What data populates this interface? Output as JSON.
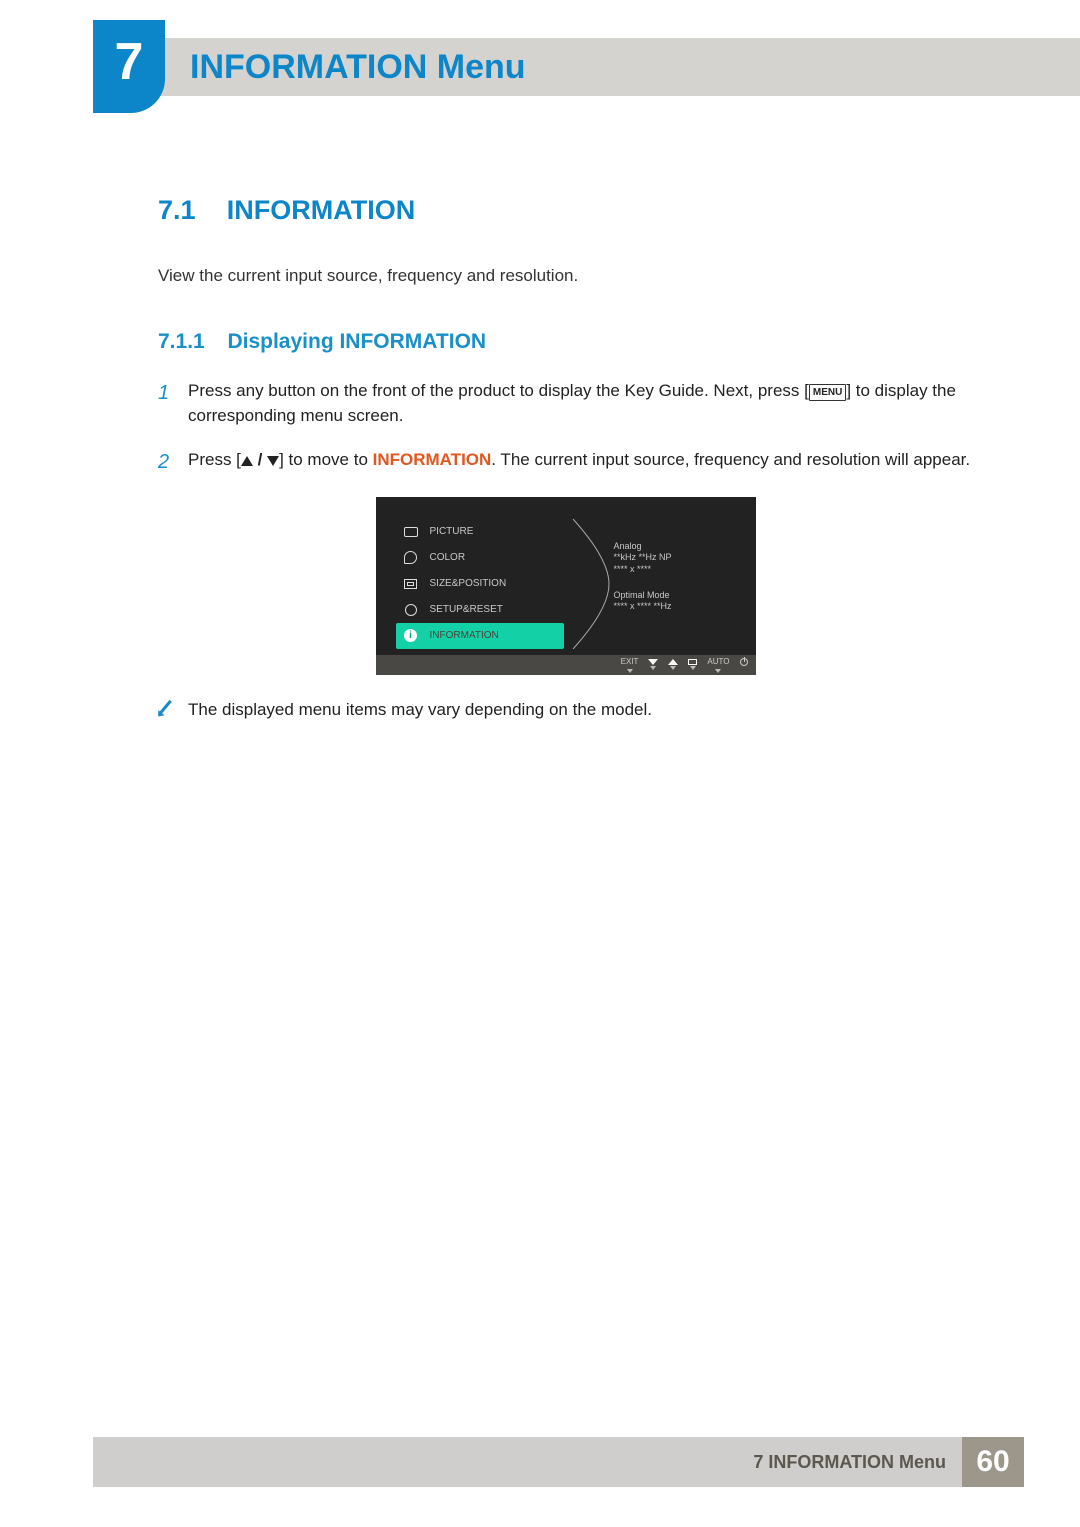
{
  "chapter": {
    "number": "7",
    "title": "INFORMATION Menu"
  },
  "section": {
    "number": "7.1",
    "title": "INFORMATION",
    "description": "View the current input source, frequency and resolution."
  },
  "subsection": {
    "number": "7.1.1",
    "title": "Displaying INFORMATION"
  },
  "steps": {
    "s1": {
      "num": "1",
      "pre": "Press any button on the front of the product to display the Key Guide. Next, press [",
      "menu": "MENU",
      "post": "] to display the corresponding menu screen."
    },
    "s2": {
      "num": "2",
      "pre": "Press [",
      "mid": "] to move to ",
      "kw": "INFORMATION",
      "post": ". The current input source, frequency and resolution will appear."
    }
  },
  "osd": {
    "items": {
      "picture": "PICTURE",
      "color": "COLOR",
      "size": "SIZE&POSITION",
      "setup": "SETUP&RESET",
      "info": "INFORMATION"
    },
    "info_block": {
      "l1": "Analog",
      "l2": "**kHz **Hz NP",
      "l3": "**** x ****",
      "l4": "Optimal Mode",
      "l5": "**** x ****  **Hz"
    },
    "buttons": {
      "exit": "EXIT",
      "auto": "AUTO"
    }
  },
  "note": "The displayed menu items may vary depending on the model.",
  "footer": {
    "label": "7 INFORMATION Menu",
    "page": "60"
  }
}
